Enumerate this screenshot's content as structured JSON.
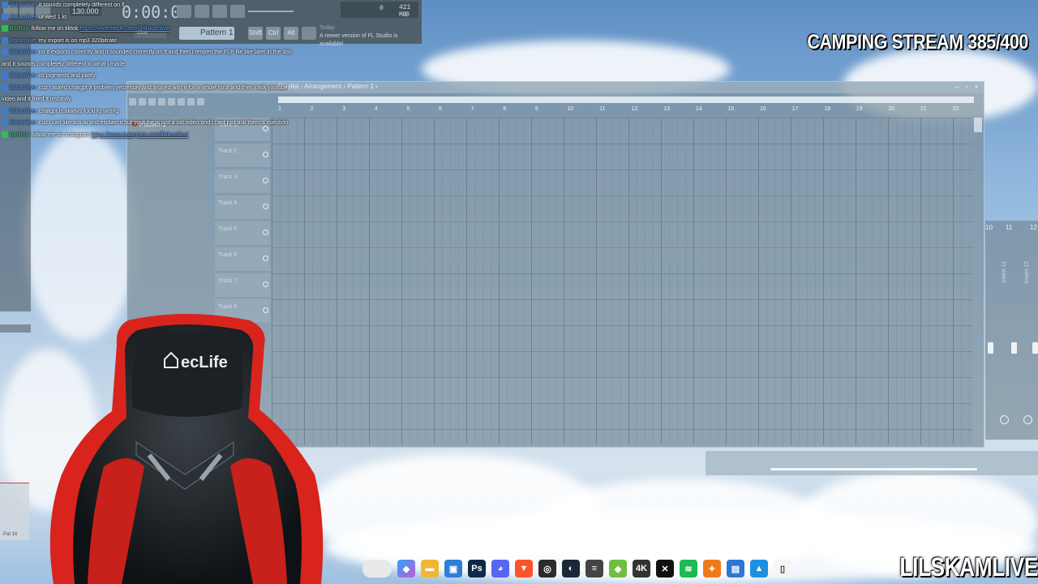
{
  "overlay": {
    "stream_title": "CAMPING STREAM 385/400",
    "watermark": "LILSKAMLIVE"
  },
  "fl_toolbar": {
    "time": "0:00:00",
    "tempo": "130.000",
    "cpu_value": "0",
    "memory": "421 MB",
    "cpu_sub": "0",
    "pattern_selector": "Pattern 1",
    "snap": "Line",
    "news_prefix": "Today",
    "news_text": "A newer version of FL Studio is available!",
    "mode_buttons": [
      "Shift",
      "Ctrl",
      "Alt"
    ]
  },
  "chat": [
    {
      "user": "lilskamlive",
      "text": "it sounds completely different on fl"
    },
    {
      "user": "lilskamlive",
      "text": "ur wed 1 kt"
    },
    {
      "user": "BotRos",
      "text": "follow me on tiktok",
      "link": "https://www.tiktok.com/@lilskamlive",
      "bot": true
    },
    {
      "user": "lilskamlive",
      "text": "my export is on mp3 320bitrate"
    },
    {
      "user": "lilskamlive",
      "text": "no it exports correctly and it sounded correctly on fl and then i reopen the FLP file like later in the day"
    },
    {
      "user": "",
      "text": "and it sounds completely different to what i made"
    },
    {
      "user": "lilskamlive",
      "text": "its pigments and partly"
    },
    {
      "user": "lilskamlive",
      "text": "cuz i asked chatgpt a problem yesterday and argued with it for a whole hour and then i ask youtube"
    },
    {
      "user": "",
      "text": "video and it fixed it instantly"
    },
    {
      "user": "lilskamlive",
      "text": "chatgpt is always fucking wrong"
    },
    {
      "user": "lilskamlive",
      "text": "cuz i can like ask ai and explain it but youtube is just a old video and i cant just ask them a question"
    },
    {
      "user": "BotRos",
      "text": "follow me on instagram",
      "link": "https://www.instagram.com/lilskamlive/",
      "bot": true
    }
  ],
  "playlist": {
    "breadcrumb": "Playlist - Arrangement › Pattern 1 ›",
    "browser_pattern": "Pattern 1",
    "bar_numbers": [
      "1",
      "2",
      "3",
      "4",
      "5",
      "6",
      "7",
      "8",
      "9",
      "10",
      "11",
      "12",
      "13",
      "14",
      "15",
      "16",
      "17",
      "18",
      "19",
      "20",
      "21",
      "22"
    ],
    "tracks": [
      "Track 1",
      "Track 2",
      "Track 3",
      "Track 4",
      "Track 5",
      "Track 6",
      "Track 7",
      "Track 8"
    ]
  },
  "mixer": {
    "numbers": [
      "10",
      "11",
      "12"
    ],
    "inserts": [
      "Insert 11",
      "Insert 12"
    ]
  },
  "chair_brand": "ecLife",
  "left_panel_label": "Pat 16",
  "taskbar_icons": [
    "search-bar-icon",
    "copilot-icon",
    "file-explorer-icon",
    "store-icon",
    "photoshop-icon",
    "discord-icon",
    "brave-icon",
    "obs-icon",
    "steam-icon",
    "app-icon",
    "bluestacks-icon",
    "4k-downloader-icon",
    "capcut-icon",
    "spotify-icon",
    "fl-studio-icon",
    "notepad-icon",
    "photos-icon",
    "file-icon"
  ],
  "colors": {
    "chat_user": "#6aa0ff",
    "chat_bot": "#45d66b",
    "chair_red": "#d8241c",
    "chair_black": "#15191d"
  }
}
